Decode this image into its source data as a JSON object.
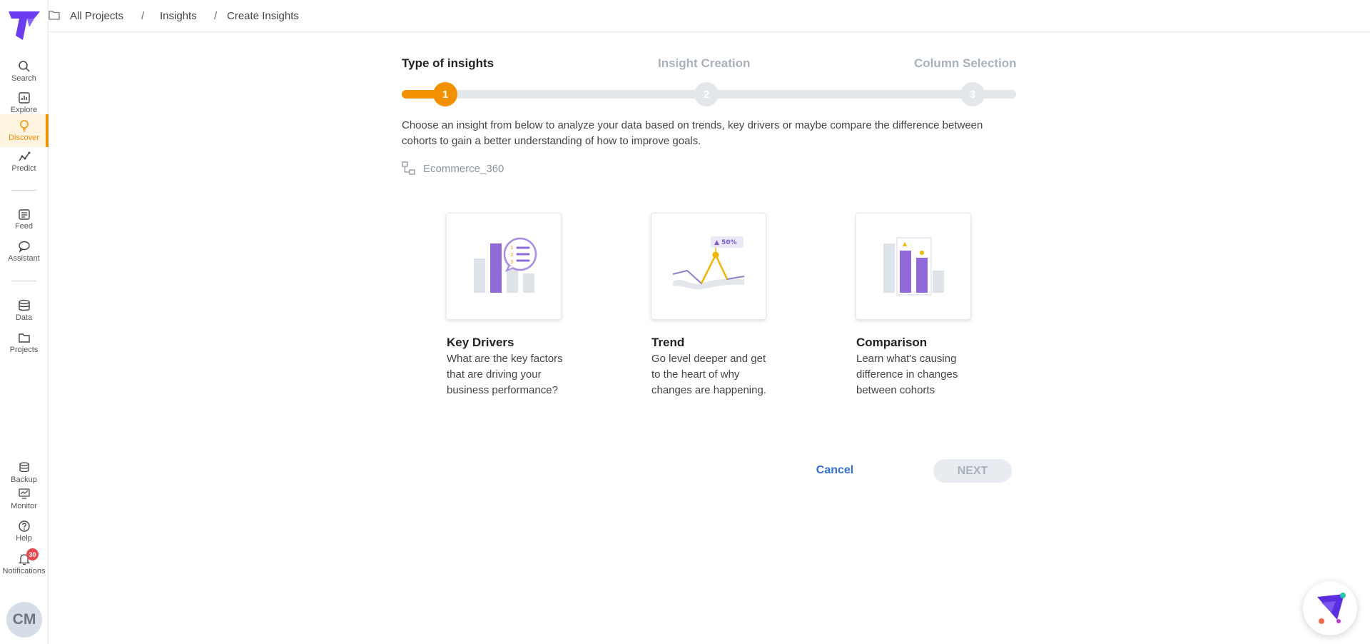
{
  "sidebar": {
    "items": [
      {
        "label": "Search",
        "icon": "search-icon"
      },
      {
        "label": "Explore",
        "icon": "chart-icon"
      },
      {
        "label": "Discover",
        "icon": "bulb-icon"
      },
      {
        "label": "Predict",
        "icon": "predict-icon"
      },
      {
        "label": "Feed",
        "icon": "feed-icon"
      },
      {
        "label": "Assistant",
        "icon": "chat-icon"
      },
      {
        "label": "Data",
        "icon": "database-icon"
      },
      {
        "label": "Projects",
        "icon": "folder-icon"
      },
      {
        "label": "Backup",
        "icon": "backup-icon"
      },
      {
        "label": "Monitor",
        "icon": "monitor-icon"
      },
      {
        "label": "Help",
        "icon": "help-icon"
      },
      {
        "label": "Notifications",
        "icon": "bell-icon"
      }
    ],
    "notification_count": "30",
    "avatar_initials": "CM"
  },
  "breadcrumb": {
    "items": [
      "All Projects",
      "Insights",
      "Create Insights"
    ],
    "separator": "/"
  },
  "stepper": {
    "steps": [
      {
        "label": "Type of insights",
        "number": "1"
      },
      {
        "label": "Insight Creation",
        "number": "2"
      },
      {
        "label": "Column Selection",
        "number": "3"
      }
    ]
  },
  "main": {
    "description": "Choose an insight from below to analyze your data based on trends, key drivers or maybe compare the difference between cohorts to gain a better understanding of how to improve goals.",
    "dataset": "Ecommerce_360",
    "cards": [
      {
        "title": "Key Drivers",
        "text": "What are the key factors that are driving your business performance?"
      },
      {
        "title": "Trend",
        "text": "Go level deeper and get to the heart of why changes are happening.",
        "badge": "▲ 50%"
      },
      {
        "title": "Comparison",
        "text": "Learn what's causing difference in changes between cohorts"
      }
    ]
  },
  "actions": {
    "cancel_label": "Cancel",
    "next_label": "NEXT"
  },
  "colors": {
    "accent": "#f29100",
    "link": "#2f6fd6",
    "brand": "#6c3cf0"
  }
}
